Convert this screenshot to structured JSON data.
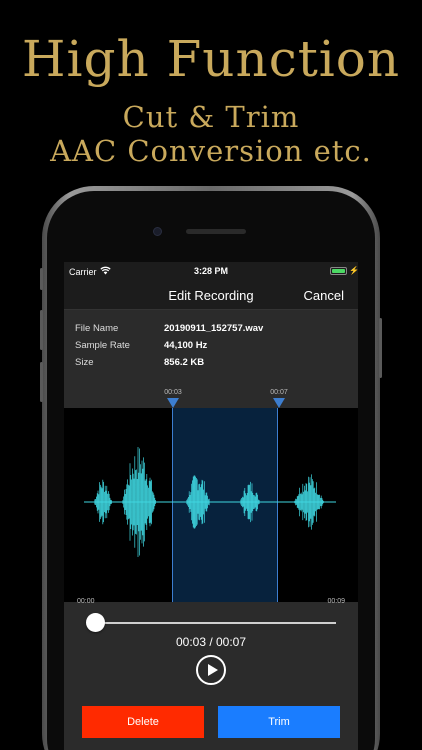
{
  "promo": {
    "headline": "High Function",
    "line1": "Cut & Trim",
    "line2": "AAC Conversion etc."
  },
  "status_bar": {
    "carrier": "Carrier",
    "time": "3:28 PM",
    "wifi_icon": "wifi-icon",
    "battery_icon": "battery-icon",
    "battery_color": "#4cd964"
  },
  "nav": {
    "title": "Edit Recording",
    "cancel_label": "Cancel"
  },
  "file_info": [
    {
      "label": "File Name",
      "value": "20190911_152757.wav"
    },
    {
      "label": "Sample Rate",
      "value": "44,100 Hz"
    },
    {
      "label": "Size",
      "value": "856.2 KB"
    }
  ],
  "selection": {
    "start_label": "00:03",
    "end_label": "00:07",
    "marker_color": "#3d7ed0"
  },
  "waveform_color": "#3fd6e0",
  "playback": {
    "start_time": "00:00",
    "end_time": "00:09",
    "position_fraction": 0.0,
    "counter": "00:03 / 00:07",
    "play_icon": "play-icon"
  },
  "actions": {
    "delete_label": "Delete",
    "delete_color": "#ff2a00",
    "trim_label": "Trim",
    "trim_color": "#1a7dff"
  }
}
